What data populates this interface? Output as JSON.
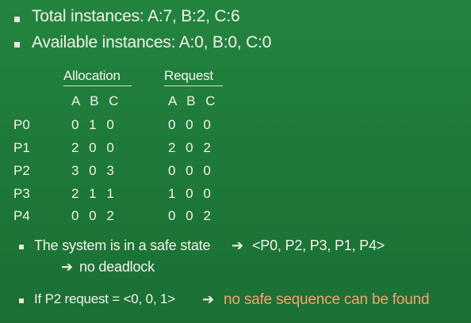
{
  "bullets": {
    "total": "Total instances: A:7, B:2, C:6",
    "available": "Available instances: A:0, B:0, C:0"
  },
  "table": {
    "alloc_header": "Allocation",
    "req_header": "Request",
    "alloc_sub": "A B C",
    "req_sub": "A B C",
    "rows": [
      {
        "proc": "P0",
        "alloc": "0 1 0",
        "req": "0 0 0"
      },
      {
        "proc": "P1",
        "alloc": "2 0 0",
        "req": "2 0 2"
      },
      {
        "proc": "P2",
        "alloc": "3 0 3",
        "req": "0 0 0"
      },
      {
        "proc": "P3",
        "alloc": "2 1 1",
        "req": "1 0 0"
      },
      {
        "proc": "P4",
        "alloc": "0 0 2",
        "req": "0 0 2"
      }
    ]
  },
  "conclusions": {
    "safe_text": "The system is in a safe state",
    "safe_seq": "<P0, P2, P3, P1, P4>",
    "no_deadlock": "no deadlock",
    "if_text": "If P2 request = <0, 0, 1>",
    "no_safe": "no safe sequence can be found"
  },
  "icons": {
    "arrow": "right-arrow-icon",
    "bullet": "square-bullet-icon"
  },
  "colors": {
    "background": "#1f7a3d",
    "text": "#f3f3ea",
    "highlight": "#f6a36b"
  }
}
